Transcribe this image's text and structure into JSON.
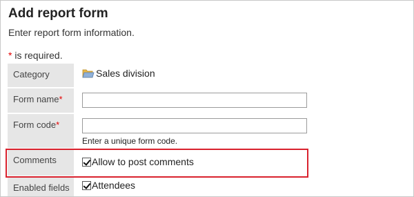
{
  "header": {
    "title": "Add report form",
    "subtitle": "Enter report form information."
  },
  "required_note": {
    "star": "*",
    "text": " is required."
  },
  "form": {
    "category": {
      "label": "Category",
      "value": "Sales division",
      "icon": "folder-icon"
    },
    "form_name": {
      "label": "Form name",
      "required_star": "*",
      "value": "",
      "placeholder": ""
    },
    "form_code": {
      "label": "Form code",
      "required_star": "*",
      "value": "",
      "placeholder": "",
      "hint": "Enter a unique form code."
    },
    "comments": {
      "label": "Comments",
      "checkbox_label": "Allow to post comments",
      "checked": true
    },
    "enabled_fields": {
      "label": "Enabled fields",
      "checkbox_label": "Attendees",
      "checked": true
    }
  },
  "highlight_color": "#d9212d",
  "required_color": "#e40000"
}
